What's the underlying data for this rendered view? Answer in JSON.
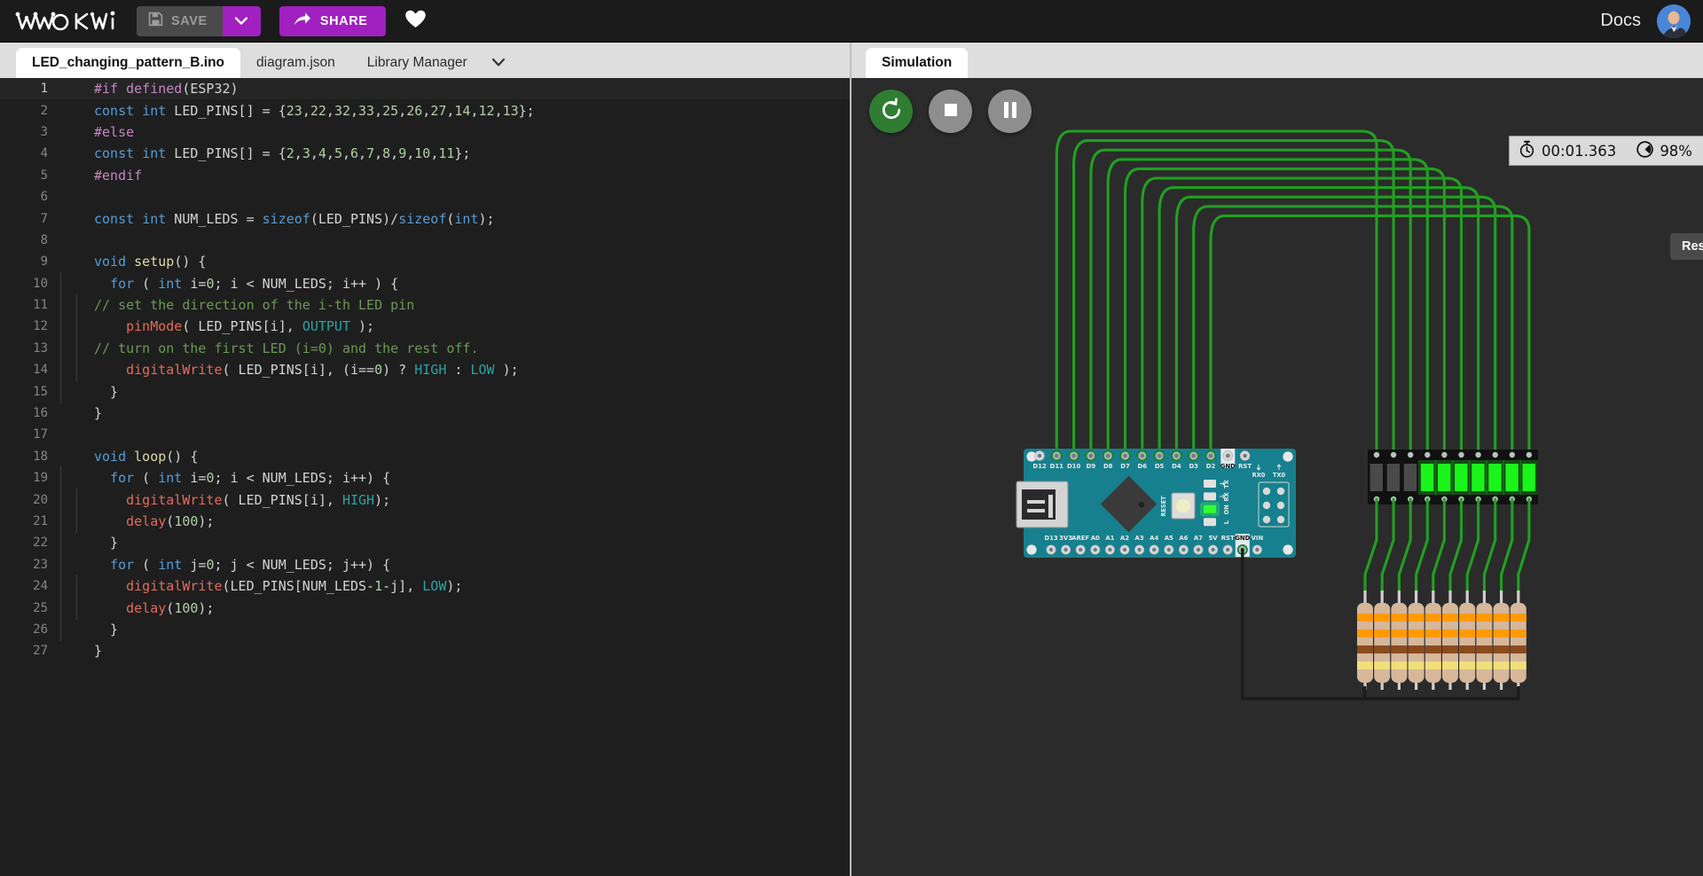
{
  "topbar": {
    "logo_text": "WOKWI",
    "save_label": "SAVE",
    "save_icon": "floppy-disk-icon",
    "save_caret_icon": "chevron-down-icon",
    "share_label": "SHARE",
    "share_icon": "share-arrow-icon",
    "heart_icon": "heart-icon",
    "docs_label": "Docs",
    "avatar_name": "user-avatar"
  },
  "editor": {
    "tabs": [
      {
        "label": "LED_changing_pattern_B.ino",
        "active": true
      },
      {
        "label": "diagram.json",
        "active": false
      },
      {
        "label": "Library Manager",
        "active": false
      }
    ],
    "tabs_caret_icon": "chevron-down-icon",
    "lines": [
      {
        "n": "1",
        "t": "#if defined(ESP32)"
      },
      {
        "n": "2",
        "t": "const int LED_PINS[] = {23,22,32,33,25,26,27,14,12,13};"
      },
      {
        "n": "3",
        "t": "#else"
      },
      {
        "n": "4",
        "t": "const int LED_PINS[] = {2,3,4,5,6,7,8,9,10,11};"
      },
      {
        "n": "5",
        "t": "#endif"
      },
      {
        "n": "6",
        "t": ""
      },
      {
        "n": "7",
        "t": "const int NUM_LEDS = sizeof(LED_PINS)/sizeof(int);"
      },
      {
        "n": "8",
        "t": ""
      },
      {
        "n": "9",
        "t": "void setup() {"
      },
      {
        "n": "10",
        "t": "  for ( int i=0; i < NUM_LEDS; i++ ) {"
      },
      {
        "n": "11",
        "t": "    // set the direction of the i-th LED pin"
      },
      {
        "n": "12",
        "t": "    pinMode( LED_PINS[i], OUTPUT );"
      },
      {
        "n": "13",
        "t": "    // turn on the first LED (i=0) and the rest off."
      },
      {
        "n": "14",
        "t": "    digitalWrite( LED_PINS[i], (i==0) ? HIGH : LOW );"
      },
      {
        "n": "15",
        "t": "  }"
      },
      {
        "n": "16",
        "t": "}"
      },
      {
        "n": "17",
        "t": ""
      },
      {
        "n": "18",
        "t": "void loop() {"
      },
      {
        "n": "19",
        "t": "  for ( int i=0; i < NUM_LEDS; i++) {"
      },
      {
        "n": "20",
        "t": "    digitalWrite( LED_PINS[i], HIGH);"
      },
      {
        "n": "21",
        "t": "    delay(100);"
      },
      {
        "n": "22",
        "t": "  }"
      },
      {
        "n": "23",
        "t": "  for ( int j=0; j < NUM_LEDS; j++) {"
      },
      {
        "n": "24",
        "t": "    digitalWrite(LED_PINS[NUM_LEDS-1-j], LOW);"
      },
      {
        "n": "25",
        "t": "    delay(100);"
      },
      {
        "n": "26",
        "t": "  }"
      },
      {
        "n": "27",
        "t": "}"
      }
    ]
  },
  "simulation": {
    "tab_label": "Simulation",
    "controls": [
      {
        "name": "restart-simulation-button",
        "icon": "restart-icon",
        "color": "#2e7d32"
      },
      {
        "name": "stop-simulation-button",
        "icon": "stop-icon",
        "color": "#8e8e8e"
      },
      {
        "name": "pause-simulation-button",
        "icon": "pause-icon",
        "color": "#8e8e8e"
      }
    ],
    "tooltip_text": "Restart the simulation",
    "status": {
      "clock_icon": "stopwatch-icon",
      "time": "00:01.363",
      "gauge_icon": "speedometer-icon",
      "speed": "98%"
    },
    "board": {
      "name": "Arduino Nano",
      "top_pins": [
        "D12",
        "D11",
        "D10",
        "D9",
        "D8",
        "D7",
        "D6",
        "D5",
        "D4",
        "D3",
        "D2",
        "GND",
        "RST"
      ],
      "top_extra": [
        "RX0",
        "TX0"
      ],
      "bottom_pins": [
        "D13",
        "3V3",
        "AREF",
        "A0",
        "A1",
        "A2",
        "A3",
        "A4",
        "A5",
        "A6",
        "A7",
        "5V",
        "RST",
        "GND",
        "VIN"
      ],
      "reset_label": "RESET",
      "led_labels": [
        "TX",
        "RX",
        "ON",
        "L"
      ],
      "body_color": "#17808e",
      "connected_pins": [
        "D11",
        "D10",
        "D9",
        "D8",
        "D7",
        "D6",
        "D5",
        "D4",
        "D3",
        "D2"
      ],
      "gnd_highlight": "GND"
    },
    "led_bar": {
      "name": "LED bar graph",
      "count": 10,
      "on_color": "#1bf51b",
      "off_color": "#4a4a4a",
      "states": [
        false,
        false,
        false,
        true,
        true,
        true,
        true,
        true,
        true,
        true
      ]
    },
    "resistors": {
      "count": 10,
      "bands": [
        "#ff9a00",
        "#ff9a00",
        "#8a4b1e",
        "#f0e07a"
      ],
      "body_color": "#d6b79a"
    },
    "wires": {
      "signal_color": "#21a021",
      "ground_color": "#1b1b1b",
      "count": 10
    }
  }
}
